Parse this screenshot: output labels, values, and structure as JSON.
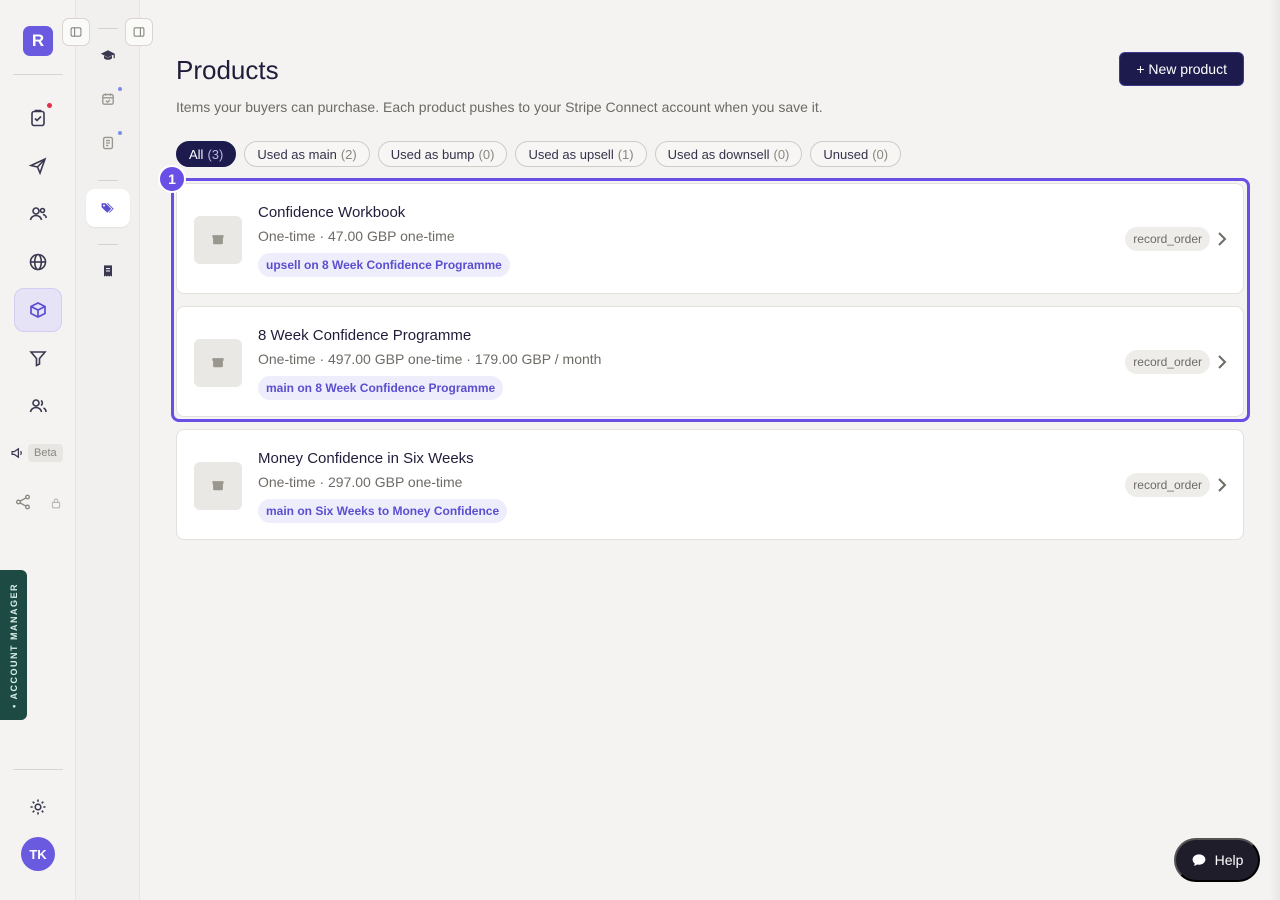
{
  "rail": {
    "brand_letter": "R",
    "beta_label": "Beta",
    "avatar_initials": "TK",
    "account_manager_label": "• ACCOUNT MANAGER"
  },
  "page": {
    "title": "Products",
    "subtitle": "Items your buyers can purchase. Each product pushes to your Stripe Connect account when you save it.",
    "new_button": "+ New product"
  },
  "filters": [
    {
      "label": "All",
      "count": "(3)"
    },
    {
      "label": "Used as main",
      "count": "(2)"
    },
    {
      "label": "Used as bump",
      "count": "(0)"
    },
    {
      "label": "Used as upsell",
      "count": "(1)"
    },
    {
      "label": "Used as downsell",
      "count": "(0)"
    },
    {
      "label": "Unused",
      "count": "(0)"
    }
  ],
  "highlight_badge": "1",
  "products": [
    {
      "name": "Confidence Workbook",
      "price": "One-time · 47.00 GBP one-time",
      "usage": "upsell on 8 Week Confidence Programme",
      "tag": "record_order"
    },
    {
      "name": "8 Week Confidence Programme",
      "price": "One-time · 497.00 GBP one-time · 179.00 GBP / month",
      "usage": "main on 8 Week Confidence Programme",
      "tag": "record_order"
    },
    {
      "name": "Money Confidence in Six Weeks",
      "price": "One-time · 297.00 GBP one-time",
      "usage": "main on Six Weeks to Money Confidence",
      "tag": "record_order"
    }
  ],
  "help": {
    "label": "Help"
  },
  "colors": {
    "accent": "#6a5ae0",
    "primary_button": "#1d1b4d",
    "highlight": "#6a4fe6"
  }
}
